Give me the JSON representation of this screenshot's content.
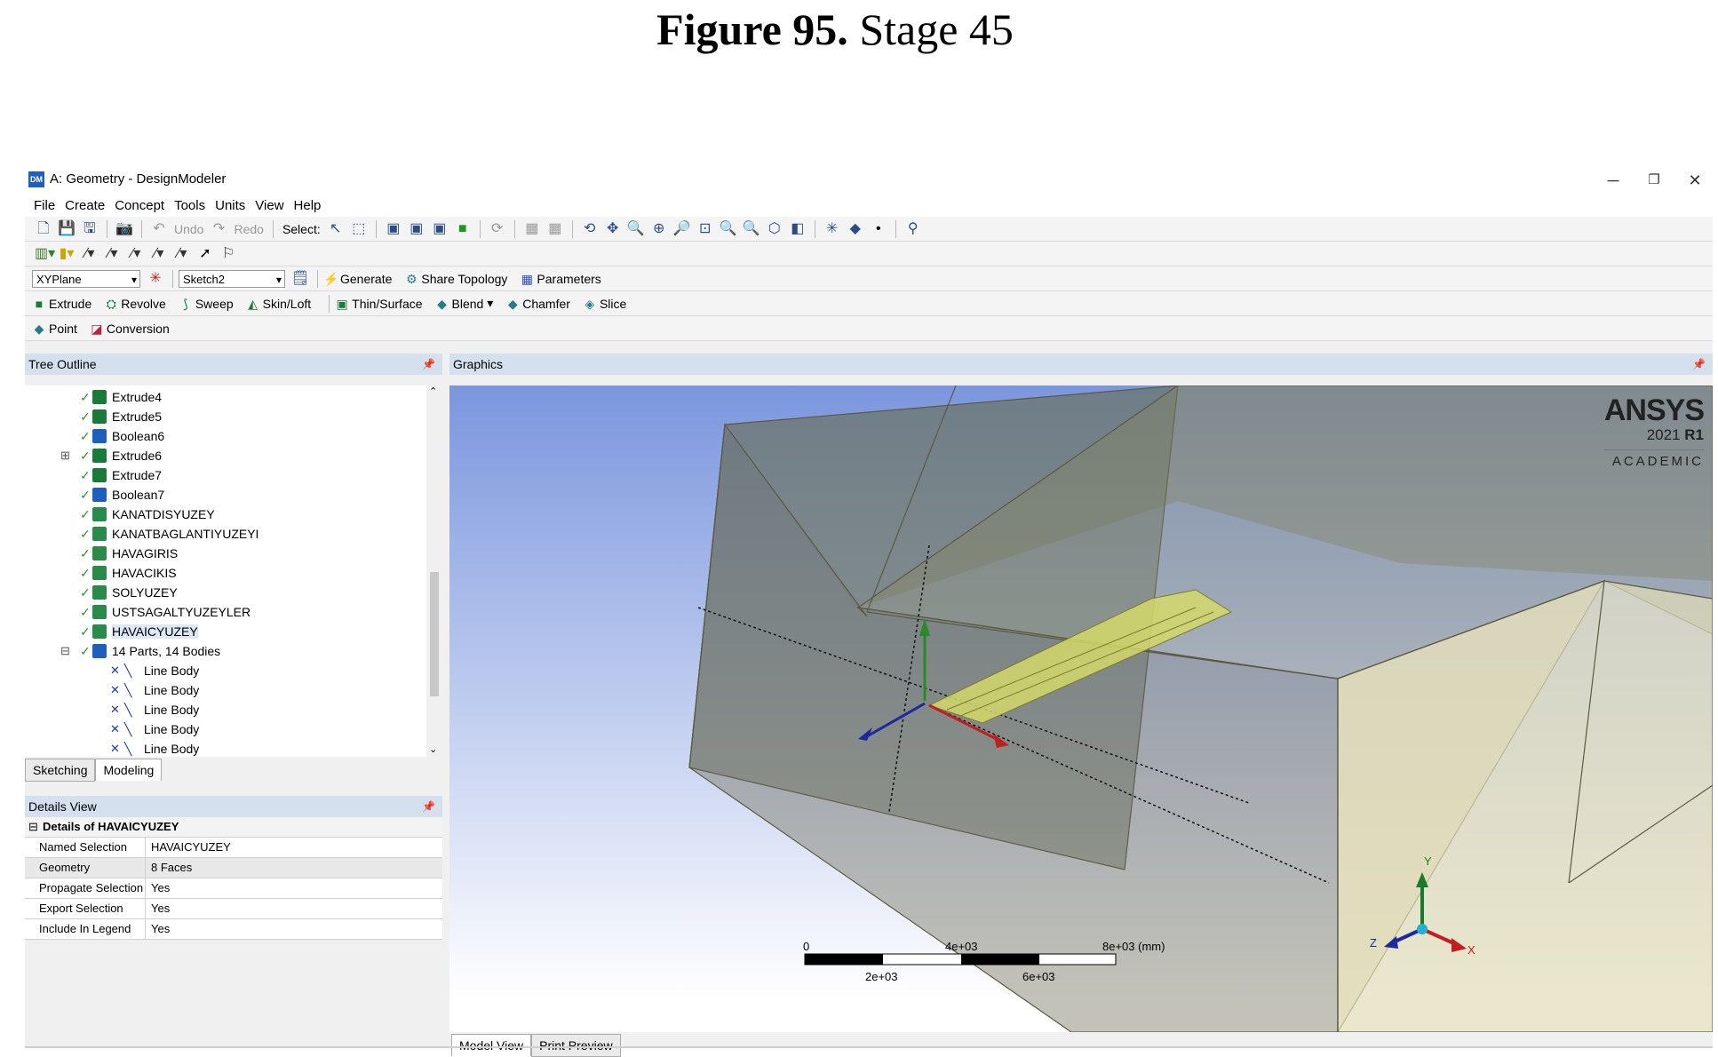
{
  "figure": {
    "label": "Figure 95.",
    "text": "Stage 45"
  },
  "window": {
    "title": "A: Geometry - DesignModeler",
    "app_icon": "DM",
    "minimize": "─",
    "restore": "❐",
    "close": "✕"
  },
  "menu": [
    "File",
    "Create",
    "Concept",
    "Tools",
    "Units",
    "View",
    "Help"
  ],
  "toolbar": {
    "undo": "Undo",
    "redo": "Redo",
    "select": "Select:"
  },
  "sketch_bar": {
    "plane": "XYPlane",
    "sketch": "Sketch2",
    "generate": "Generate",
    "share_topology": "Share Topology",
    "parameters": "Parameters"
  },
  "features": [
    "Extrude",
    "Revolve",
    "Sweep",
    "Skin/Loft",
    "Thin/Surface",
    "Blend",
    "Chamfer",
    "Slice"
  ],
  "features2": [
    "Point",
    "Conversion"
  ],
  "tree": {
    "header": "Tree Outline",
    "items": [
      {
        "label": "Extrude4",
        "icon": "extrude-icon"
      },
      {
        "label": "Extrude5",
        "icon": "extrude-icon"
      },
      {
        "label": "Boolean6",
        "icon": "boolean-icon"
      },
      {
        "label": "Extrude6",
        "icon": "extrude-icon"
      },
      {
        "label": "Extrude7",
        "icon": "extrude-icon"
      },
      {
        "label": "Boolean7",
        "icon": "boolean-icon"
      },
      {
        "label": "KANATDISYUZEY",
        "icon": "named-selection-icon"
      },
      {
        "label": "KANATBAGLANTIYUZEYI",
        "icon": "named-selection-icon"
      },
      {
        "label": "HAVAGIRIS",
        "icon": "named-selection-icon"
      },
      {
        "label": "HAVACIKIS",
        "icon": "named-selection-icon"
      },
      {
        "label": "SOLYUZEY",
        "icon": "named-selection-icon"
      },
      {
        "label": "USTSAGALTYUZEYLER",
        "icon": "named-selection-icon"
      },
      {
        "label": "HAVAICYUZEY",
        "icon": "named-selection-icon"
      },
      {
        "label": "14 Parts, 14 Bodies",
        "icon": "parts-icon"
      },
      {
        "label": "Line Body",
        "icon": "line-body-icon"
      },
      {
        "label": "Line Body",
        "icon": "line-body-icon"
      },
      {
        "label": "Line Body",
        "icon": "line-body-icon"
      },
      {
        "label": "Line Body",
        "icon": "line-body-icon"
      },
      {
        "label": "Line Body",
        "icon": "line-body-icon"
      }
    ]
  },
  "tabs": [
    "Sketching",
    "Modeling"
  ],
  "details": {
    "header": "Details View",
    "group": "Details of HAVAICYUZEY",
    "rows": [
      {
        "key": "Named Selection",
        "value": "HAVAICYUZEY"
      },
      {
        "key": "Geometry",
        "value": "8 Faces"
      },
      {
        "key": "Propagate Selection",
        "value": "Yes"
      },
      {
        "key": "Export Selection",
        "value": "Yes"
      },
      {
        "key": "Include In Legend",
        "value": "Yes"
      }
    ]
  },
  "graphics": {
    "header": "Graphics",
    "brand": "ANSYS",
    "version": "2021",
    "release": "R1",
    "edition": "ACADEMIC",
    "scale": {
      "t0": "0",
      "t1": "2e+03",
      "t2": "4e+03",
      "t3": "6e+03",
      "t4": "8e+03 (mm)"
    },
    "axes": {
      "x": "X",
      "y": "Y",
      "z": "Z"
    },
    "tabs": [
      "Model View",
      "Print Preview"
    ]
  },
  "colors": {
    "panel_header": "#d4e0ee",
    "body": "#7d7a52",
    "wing": "#d4d96a"
  }
}
